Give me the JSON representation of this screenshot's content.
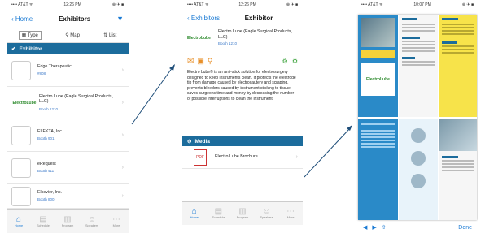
{
  "phone1": {
    "status": {
      "carrier": "•••• AT&T ᯤ",
      "time": "12:26 PM",
      "battery": "⊕ ✈ ■"
    },
    "nav": {
      "back": "‹ Home",
      "title": "Exhibitors",
      "filter_icon": "filter-icon"
    },
    "tabs": [
      {
        "label": "Type",
        "icon": "grid-icon"
      },
      {
        "label": "Map",
        "icon": "pin-icon"
      },
      {
        "label": "List",
        "icon": "az-icon"
      }
    ],
    "section": "Exhibitor",
    "rows": [
      {
        "name": "Edge Therapeutic",
        "sub": "#808"
      },
      {
        "name": "Electro Lube (Eagle Surgical Products, LLC)",
        "sub": "Booth 1210"
      },
      {
        "name": "ELEKTA, Inc.",
        "sub": "Booth 901"
      },
      {
        "name": "eRequest",
        "sub": "Booth 411"
      },
      {
        "name": "Elsevier, Inc.",
        "sub": "Booth 800"
      }
    ],
    "tabbar": [
      "Home",
      "Schedule",
      "Program",
      "Speakers",
      "More"
    ],
    "accent": "#1a7ad4",
    "section_color": "#1c6c9c"
  },
  "phone2": {
    "status": {
      "carrier": "•••• AT&T ᯤ",
      "time": "12:26 PM",
      "battery": "⊕ ✈ ■"
    },
    "nav": {
      "back": "‹ Exhibitors",
      "title": "Exhibitor"
    },
    "header": {
      "logo": "ElectroLube",
      "name": "Electro Lube (Eagle Surgical Products, LLC)",
      "booth": "Booth 1210"
    },
    "description": "Electro Lube® is an anti-stick solution for electrosurgery designed to keep instruments clean. It protects the electrode tip from damage caused by electrocautery and scraping, prevents bleeders caused by instrument sticking to tissue, saves surgeons time and money by decreasing the number of possible interruptions to clean the instrument.",
    "section": "Media",
    "media_title": "Electro Lube Brochure",
    "tabbar": [
      "Home",
      "Schedule",
      "Program",
      "Speakers",
      "More"
    ]
  },
  "phone3": {
    "status": {
      "carrier": "•••• AT&T ᯤ",
      "time": "10:07 PM",
      "battery": "⊕ ✈ ■"
    },
    "toolbar": {
      "done": "Done"
    }
  }
}
